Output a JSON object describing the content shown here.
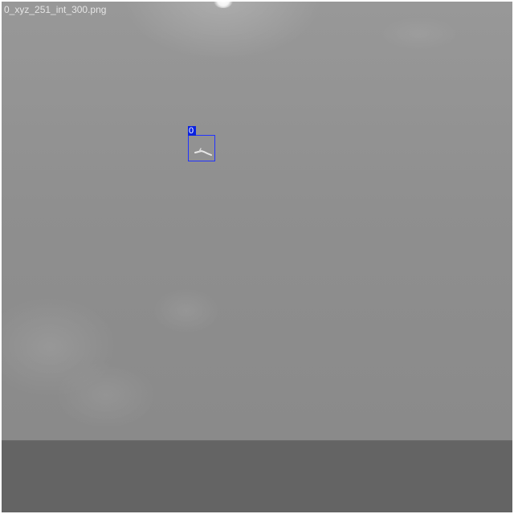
{
  "viewer": {
    "filename": "0_xyz_251_int_300.png"
  },
  "detections": [
    {
      "label": "0",
      "box_color": "#2233ff",
      "label_bg_color": "#0a22e0"
    }
  ],
  "colors": {
    "sky": "#8f8f8f",
    "ground": "#646464",
    "text": "#e6e6e6"
  }
}
